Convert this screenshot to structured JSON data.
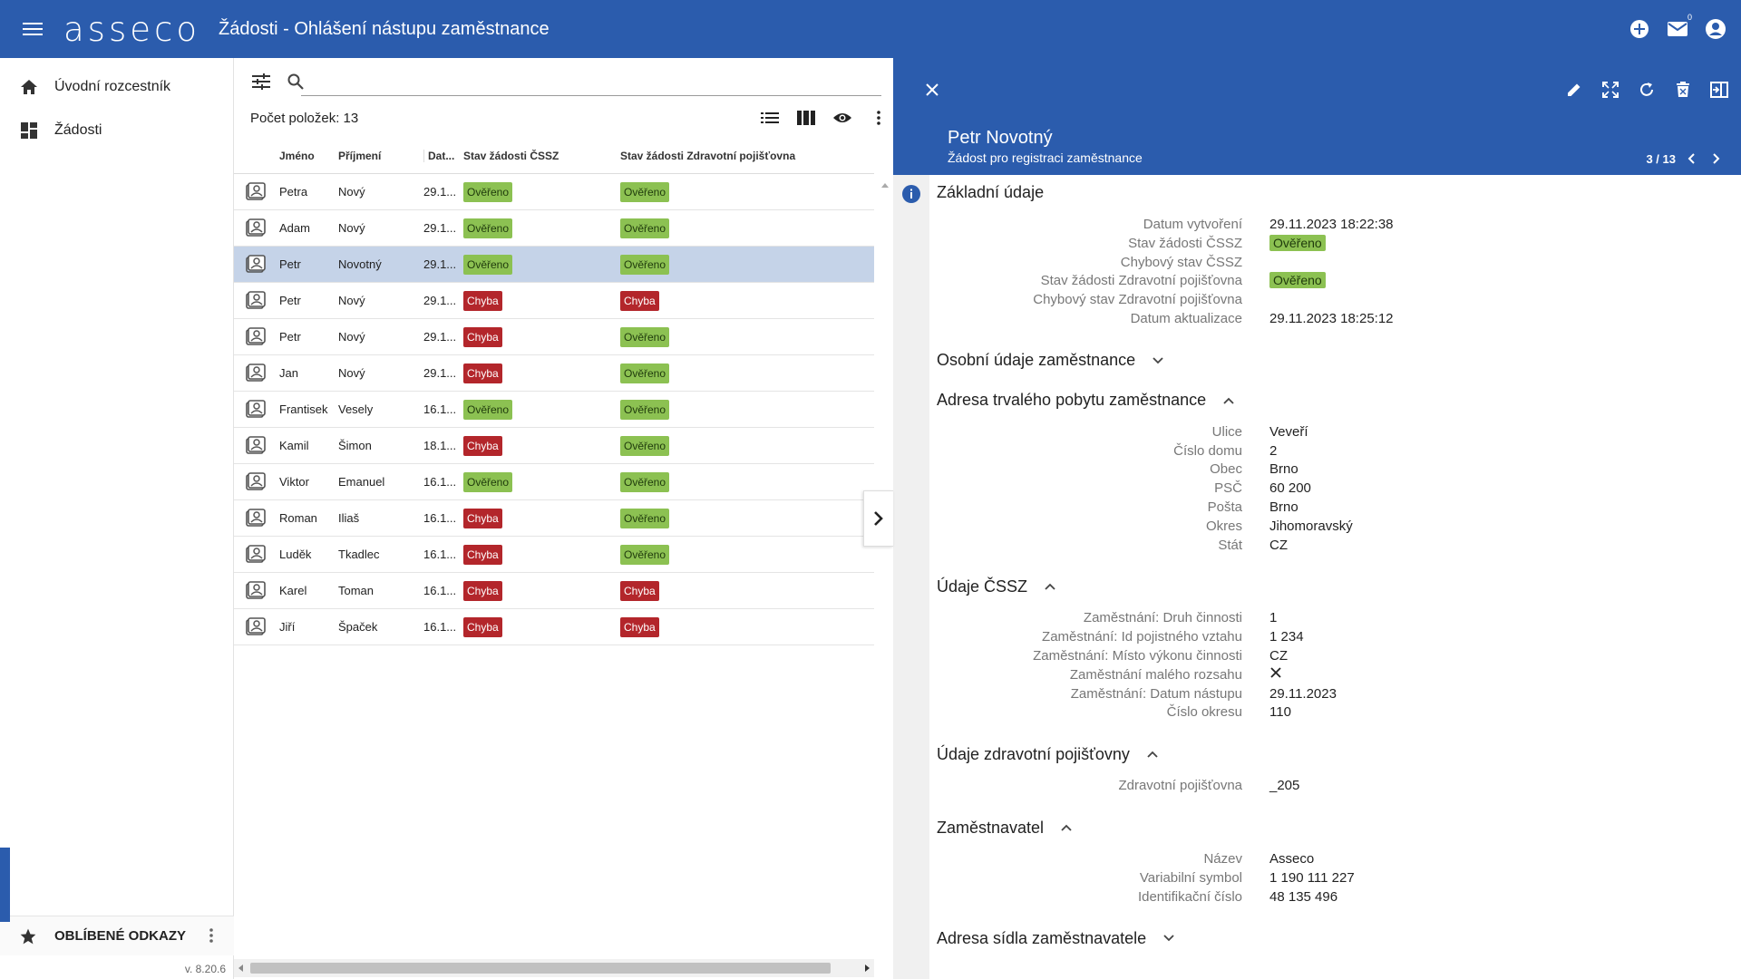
{
  "header": {
    "logo": "asseco",
    "title": "Žádosti - Ohlášení nástupu zaměstnance",
    "mail_badge": "0"
  },
  "sidebar": {
    "items": [
      {
        "label": "Úvodní rozcestník",
        "icon": "home-icon"
      },
      {
        "label": "Žádosti",
        "icon": "dashboard-icon"
      }
    ],
    "favorites_label": "OBLÍBENÉ ODKAZY",
    "version": "v. 8.20.6"
  },
  "list": {
    "search": {
      "value": "",
      "placeholder": ""
    },
    "count_label": "Počet položek: 13",
    "columns": [
      "Jméno",
      "Příjmení",
      "Dat...",
      "Stav žádosti ČSSZ",
      "Stav žádosti Zdravotní pojišťovna"
    ],
    "rows": [
      {
        "first": "Petra",
        "last": "Nový",
        "date": "29.1...",
        "cssz": "Ověřeno",
        "zp": "Ověřeno",
        "selected": false
      },
      {
        "first": "Adam",
        "last": "Nový",
        "date": "29.1...",
        "cssz": "Ověřeno",
        "zp": "Ověřeno",
        "selected": false
      },
      {
        "first": "Petr",
        "last": "Novotný",
        "date": "29.1...",
        "cssz": "Ověřeno",
        "zp": "Ověřeno",
        "selected": true
      },
      {
        "first": "Petr",
        "last": "Nový",
        "date": "29.1...",
        "cssz": "Chyba",
        "zp": "Chyba",
        "selected": false
      },
      {
        "first": "Petr",
        "last": "Nový",
        "date": "29.1...",
        "cssz": "Chyba",
        "zp": "Ověřeno",
        "selected": false
      },
      {
        "first": "Jan",
        "last": "Nový",
        "date": "29.1...",
        "cssz": "Chyba",
        "zp": "Ověřeno",
        "selected": false
      },
      {
        "first": "Frantisek",
        "last": "Vesely",
        "date": "16.1...",
        "cssz": "Ověřeno",
        "zp": "Ověřeno",
        "selected": false
      },
      {
        "first": "Kamil",
        "last": "Šimon",
        "date": "18.1...",
        "cssz": "Chyba",
        "zp": "Ověřeno",
        "selected": false
      },
      {
        "first": "Viktor",
        "last": "Emanuel",
        "date": "16.1...",
        "cssz": "Ověřeno",
        "zp": "Ověřeno",
        "selected": false
      },
      {
        "first": "Roman",
        "last": "Iliaš",
        "date": "16.1...",
        "cssz": "Chyba",
        "zp": "Ověřeno",
        "selected": false
      },
      {
        "first": "Luděk",
        "last": "Tkadlec",
        "date": "16.1...",
        "cssz": "Chyba",
        "zp": "Ověřeno",
        "selected": false
      },
      {
        "first": "Karel",
        "last": "Toman",
        "date": "16.1...",
        "cssz": "Chyba",
        "zp": "Chyba",
        "selected": false
      },
      {
        "first": "Jiří",
        "last": "Špaček",
        "date": "16.1...",
        "cssz": "Chyba",
        "zp": "Chyba",
        "selected": false
      }
    ]
  },
  "detail": {
    "name": "Petr Novotný",
    "subtitle": "Žádost pro registraci zaměstnance",
    "pager": "3 / 13",
    "sections": [
      {
        "title": "Základní údaje",
        "toggle": "",
        "fields": [
          {
            "k": "Datum vytvoření",
            "v": "29.11.2023 18:22:38"
          },
          {
            "k": "Stav žádosti ČSSZ",
            "v": "Ověřeno",
            "pill": "ok"
          },
          {
            "k": "Chybový stav ČSSZ",
            "v": ""
          },
          {
            "k": "Stav žádosti Zdravotní pojišťovna",
            "v": "Ověřeno",
            "pill": "ok"
          },
          {
            "k": "Chybový stav Zdravotní pojišťovna",
            "v": ""
          },
          {
            "k": "Datum aktualizace",
            "v": "29.11.2023 18:25:12"
          }
        ]
      },
      {
        "title": "Osobní údaje zaměstnance",
        "toggle": "down",
        "fields": []
      },
      {
        "title": "Adresa trvalého pobytu zaměstnance",
        "toggle": "up",
        "fields": [
          {
            "k": "Ulice",
            "v": "Veveří"
          },
          {
            "k": "Číslo domu",
            "v": "2"
          },
          {
            "k": "Obec",
            "v": "Brno"
          },
          {
            "k": "PSČ",
            "v": "60 200"
          },
          {
            "k": "Pošta",
            "v": "Brno"
          },
          {
            "k": "Okres",
            "v": "Jihomoravský"
          },
          {
            "k": "Stát",
            "v": "CZ"
          }
        ]
      },
      {
        "title": "Údaje ČSSZ",
        "toggle": "up",
        "fields": [
          {
            "k": "Zaměstnání: Druh činnosti",
            "v": "1"
          },
          {
            "k": "Zaměstnání: Id pojistného vztahu",
            "v": "1 234"
          },
          {
            "k": "Zaměstnání: Místo výkonu činnosti",
            "v": "CZ"
          },
          {
            "k": "Zaměstnání malého rozsahu",
            "v": "",
            "cross": true
          },
          {
            "k": "Zaměstnání: Datum nástupu",
            "v": "29.11.2023"
          },
          {
            "k": "Číslo okresu",
            "v": "110"
          }
        ]
      },
      {
        "title": "Údaje zdravotní pojišťovny",
        "toggle": "up",
        "fields": [
          {
            "k": "Zdravotní pojišťovna",
            "v": "_205"
          }
        ]
      },
      {
        "title": "Zaměstnavatel",
        "toggle": "up",
        "fields": [
          {
            "k": "Název",
            "v": "Asseco"
          },
          {
            "k": "Variabilní symbol",
            "v": "1 190 111 227"
          },
          {
            "k": "Identifikační číslo",
            "v": "48 135 496"
          }
        ]
      },
      {
        "title": "Adresa sídla zaměstnavatele",
        "toggle": "down",
        "fields": []
      }
    ]
  },
  "colors": {
    "brand": "#2b5cad",
    "ok": "#8cc152",
    "error": "#b3262b",
    "selected_row": "#c5d3e8"
  }
}
